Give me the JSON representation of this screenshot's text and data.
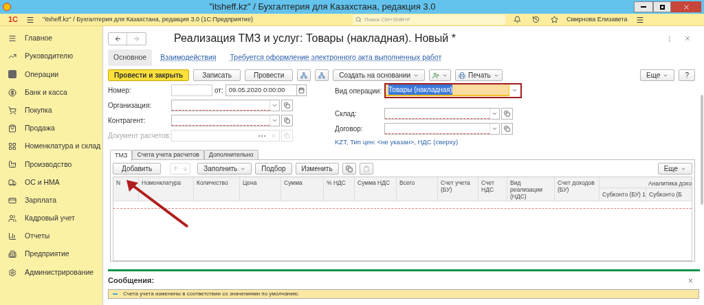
{
  "window": {
    "title": "\"itsheff.kz\" / Бухгалтерия для Казахстана, редакция 3.0"
  },
  "app_header": {
    "logo": "1С",
    "title": "\"itsheff.kz\" / Бухгалтерия для Казахстана, редакция 3.0  (1С:Предприятие)",
    "search_placeholder": "Поиск Ctrl+Shift+F",
    "user": "Смирнова Елизавета"
  },
  "sidebar": {
    "items": [
      {
        "label": "Главное"
      },
      {
        "label": "Руководителю"
      },
      {
        "label": "Операции"
      },
      {
        "label": "Банк и касса"
      },
      {
        "label": "Покупка"
      },
      {
        "label": "Продажа"
      },
      {
        "label": "Номенклатура и склад"
      },
      {
        "label": "Производство"
      },
      {
        "label": "ОС и НМА"
      },
      {
        "label": "Зарплата"
      },
      {
        "label": "Кадровый учет"
      },
      {
        "label": "Отчеты"
      },
      {
        "label": "Предприятие"
      },
      {
        "label": "Администрирование"
      }
    ]
  },
  "document": {
    "title": "Реализация ТМЗ и услуг: Товары (накладная). Новый *",
    "tabs": [
      {
        "label": "Основное",
        "selected": true
      },
      {
        "label": "Взаимодействия",
        "selected": false
      },
      {
        "label": "Требуется оформление электронного акта выполненных работ",
        "selected": false
      }
    ],
    "toolbar": [
      {
        "kind": "primary",
        "label": "Провести и закрыть"
      },
      {
        "kind": "button",
        "label": "Записать"
      },
      {
        "kind": "button",
        "label": "Провести"
      },
      {
        "kind": "icon"
      },
      {
        "kind": "icon"
      },
      {
        "kind": "dropdown",
        "label": "Создать на основании"
      },
      {
        "kind": "icon-dropdown"
      },
      {
        "kind": "print",
        "label": "Печать"
      }
    ],
    "more_button": "Еще",
    "help_button": "?",
    "number": {
      "label": "Номер:"
    },
    "date": {
      "label": "от:",
      "value": "09.05.2020  0:00:00"
    },
    "left_fields": [
      {
        "label": "Организация:",
        "disabled": false
      },
      {
        "label": "Контрагент:",
        "disabled": false
      },
      {
        "label": "Документ расчетов:",
        "disabled": true
      }
    ],
    "operation": {
      "label": "Вид операции:",
      "value": "Товары (накладная)"
    },
    "right_fields": [
      {
        "label": "Склад:"
      },
      {
        "label": "Договор:"
      }
    ],
    "price_info": "KZT, Тип цен: <не указан>, НДС (сверху)",
    "sections": [
      {
        "label": "ТМЗ",
        "selected": true
      },
      {
        "label": "Счета учета расчетов",
        "selected": false
      },
      {
        "label": "Дополнительно",
        "selected": false
      }
    ],
    "table_toolbar": {
      "add": "Добавить",
      "fill": "Заполнить",
      "pick": "Подбор",
      "change": "Изменить",
      "more": "Еще"
    },
    "table": {
      "columns": [
        "N",
        "Номенклатура",
        "Количество",
        "Цена",
        "Сумма",
        "% НДС",
        "Сумма НДС",
        "Всего",
        "Счет учета (БУ)",
        "Счет НДС",
        "Вид реализации (НДС)",
        "Счет доходов (БУ)"
      ],
      "group": "Аналитика дохо",
      "subcolumns": [
        "Субконто (БУ) 1",
        "Субконто (Б"
      ]
    }
  },
  "messages": {
    "title": "Сообщения:",
    "items": [
      "Счета учета изменены в соответствии со значениями по умолчанию."
    ]
  }
}
